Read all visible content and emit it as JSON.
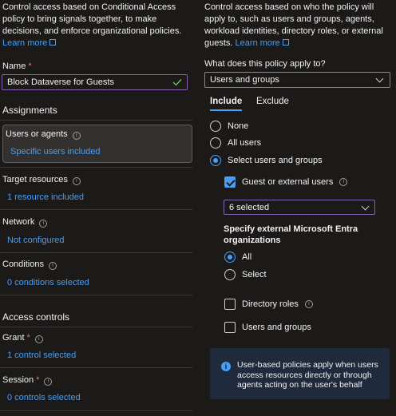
{
  "left": {
    "intro_lines": [
      "Control access based on Conditional Access",
      "policy to bring signals together, to make",
      "decisions, and enforce organizational policies."
    ],
    "learn_more": "Learn more",
    "name_label": "Name",
    "name_required": "*",
    "name_value": "Block Dataverse for Guests",
    "assignments_title": "Assignments",
    "users_label": "Users or agents",
    "users_value": "Specific users included",
    "target_label": "Target resources",
    "target_value": "1 resource included",
    "network_label": "Network",
    "network_value": "Not configured",
    "conditions_label": "Conditions",
    "conditions_value": "0 conditions selected",
    "access_title": "Access controls",
    "grant_label": "Grant",
    "grant_required": "*",
    "grant_value": "1 control selected",
    "session_label": "Session",
    "session_required": "*",
    "session_value": "0 controls selected"
  },
  "right": {
    "intro_lines": [
      "Control access based on who the policy will",
      "apply to, such as users and groups, agents,",
      "workload identities, directory roles, or external",
      "guests."
    ],
    "learn_more": "Learn more",
    "applies_label": "What does this policy apply to?",
    "applies_value": "Users and groups",
    "tab_include": "Include",
    "tab_exclude": "Exclude",
    "radio_none": "None",
    "radio_all_users": "All users",
    "radio_select": "Select users and groups",
    "guest_label": "Guest or external users",
    "guest_dropdown": "6 selected",
    "orgs_title_line1": "Specify external Microsoft Entra",
    "orgs_title_line2": "organizations",
    "org_all": "All",
    "org_select": "Select",
    "directory_roles": "Directory roles",
    "users_groups": "Users and groups",
    "info_lines": [
      "User-based policies apply when users",
      "access resources directly or through",
      "agents acting on the user's behalf"
    ],
    "info_icon": "i"
  },
  "colors": {
    "accent": "#479ef5",
    "success": "#6ccb5f",
    "required": "#f1707b",
    "name_border": "#8764b8"
  }
}
